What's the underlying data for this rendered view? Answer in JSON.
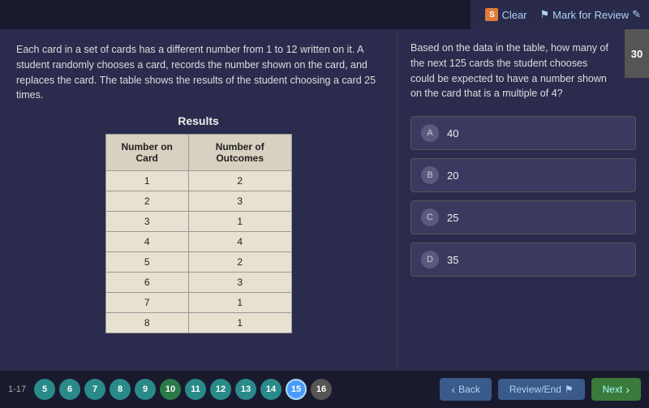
{
  "topbar": {
    "clear_label": "Clear",
    "mark_label": "Mark for Review"
  },
  "left": {
    "problem_text": "Each card in a set of cards has a different number from 1 to 12 written on it. A student randomly chooses a card, records the number shown on the card, and replaces the card. The table shows the results of the student choosing a card 25 times.",
    "results_label": "Results",
    "table": {
      "col1": "Number on Card",
      "col2": "Number of Outcomes",
      "rows": [
        {
          "card": "1",
          "outcomes": "2"
        },
        {
          "card": "2",
          "outcomes": "3"
        },
        {
          "card": "3",
          "outcomes": "1"
        },
        {
          "card": "4",
          "outcomes": "4"
        },
        {
          "card": "5",
          "outcomes": "2"
        },
        {
          "card": "6",
          "outcomes": "3"
        },
        {
          "card": "7",
          "outcomes": "1"
        },
        {
          "card": "8",
          "outcomes": "1"
        }
      ]
    }
  },
  "right": {
    "question_text": "Based on the data in the table, how many of the next 125 cards the student chooses could be expected to have a number shown on the card that is a multiple of 4?",
    "question_number": "30",
    "choices": [
      {
        "letter": "A",
        "value": "40"
      },
      {
        "letter": "B",
        "value": "20"
      },
      {
        "letter": "C",
        "value": "25"
      },
      {
        "letter": "D",
        "value": "35"
      }
    ]
  },
  "bottom": {
    "page_range": "1-17",
    "nav_items": [
      {
        "num": "5",
        "style": "teal"
      },
      {
        "num": "6",
        "style": "teal"
      },
      {
        "num": "7",
        "style": "teal"
      },
      {
        "num": "8",
        "style": "teal"
      },
      {
        "num": "9",
        "style": "teal"
      },
      {
        "num": "10",
        "style": "green"
      },
      {
        "num": "11",
        "style": "teal"
      },
      {
        "num": "12",
        "style": "teal"
      },
      {
        "num": "13",
        "style": "teal"
      },
      {
        "num": "14",
        "style": "teal"
      },
      {
        "num": "15",
        "style": "active"
      },
      {
        "num": "16",
        "style": "default"
      }
    ],
    "back_label": "Back",
    "review_label": "Review/End",
    "next_label": "Next"
  }
}
